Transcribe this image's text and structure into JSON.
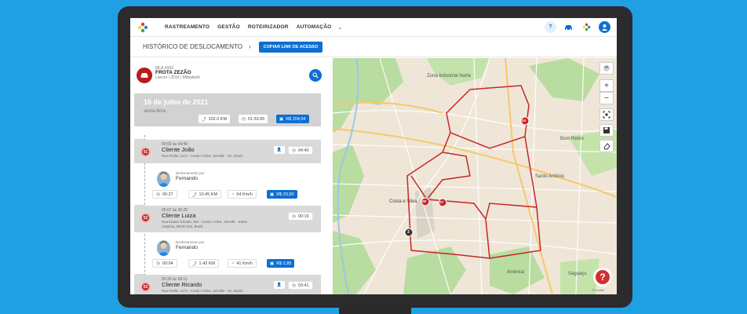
{
  "nav": {
    "items": [
      "RASTREAMENTO",
      "GESTÃO",
      "ROTEIRIZADOR",
      "AUTOMAÇÃO"
    ],
    "help_label": "?"
  },
  "header": {
    "title": "HISTÓRICO DE DESLOCAMENTO",
    "copy_button": "COPIAR LINK DE ACESSO"
  },
  "vehicle": {
    "plate": "MLA-4333",
    "name": "FROTA ZEZÃO",
    "model": "Lancer | 2014 | Mitsubishi"
  },
  "day": {
    "date": "16 de julho de 2021",
    "weekday": "sexta-feira",
    "distance": "102.0 KM",
    "duration": "01:33:05",
    "cost": "R$ 204,04"
  },
  "stops": [
    {
      "label": "parada",
      "number": "01",
      "time": "00:00 às 04:40",
      "name": "Cliente João",
      "address": "Rua Pavão, 1271 - Costa e Silva, Joinville - SC, Brasil ...",
      "duration": "04:40"
    },
    {
      "label": "parada",
      "number": "02",
      "time": "05:07 às 05:26",
      "name": "Cliente Luiza",
      "address": "Rua Duarte Schutel, 330 - Costa e Silva, Joinville - Santa Catarina, 89220-310, Brasil ...",
      "duration": "00:19"
    },
    {
      "label": "parada",
      "number": "03",
      "time": "05:30 às 09:11",
      "name": "Cliente Ricardo",
      "address": "Rua Pavão, 1271 - Costa e Silva, Joinville - SC, Brasil ...",
      "duration": "03:41"
    }
  ],
  "moves": [
    {
      "label": "Deslocamento por",
      "driver": "Fernando",
      "duration": "00:27",
      "distance": "10.45 KM",
      "speed": "54 Km/h",
      "cost": "R$ 20,90"
    },
    {
      "label": "Deslocamento por",
      "driver": "Fernando",
      "duration": "00:04",
      "distance": "1.43 KM",
      "speed": "41 Km/h",
      "cost": "R$ 2,85"
    }
  ],
  "map": {
    "markers": [
      "04",
      "08",
      "07",
      "3"
    ],
    "labels": [
      "Zona Industrial Norte",
      "Santo Antônio",
      "Bom Retiro",
      "Costa e Silva",
      "Saguaçu",
      "América"
    ],
    "controls": [
      "+",
      "−"
    ],
    "attribution": "© Leaflet"
  },
  "colors": {
    "accent": "#0d6fd0",
    "route": "#c62828",
    "background": "#1ea0e2"
  }
}
